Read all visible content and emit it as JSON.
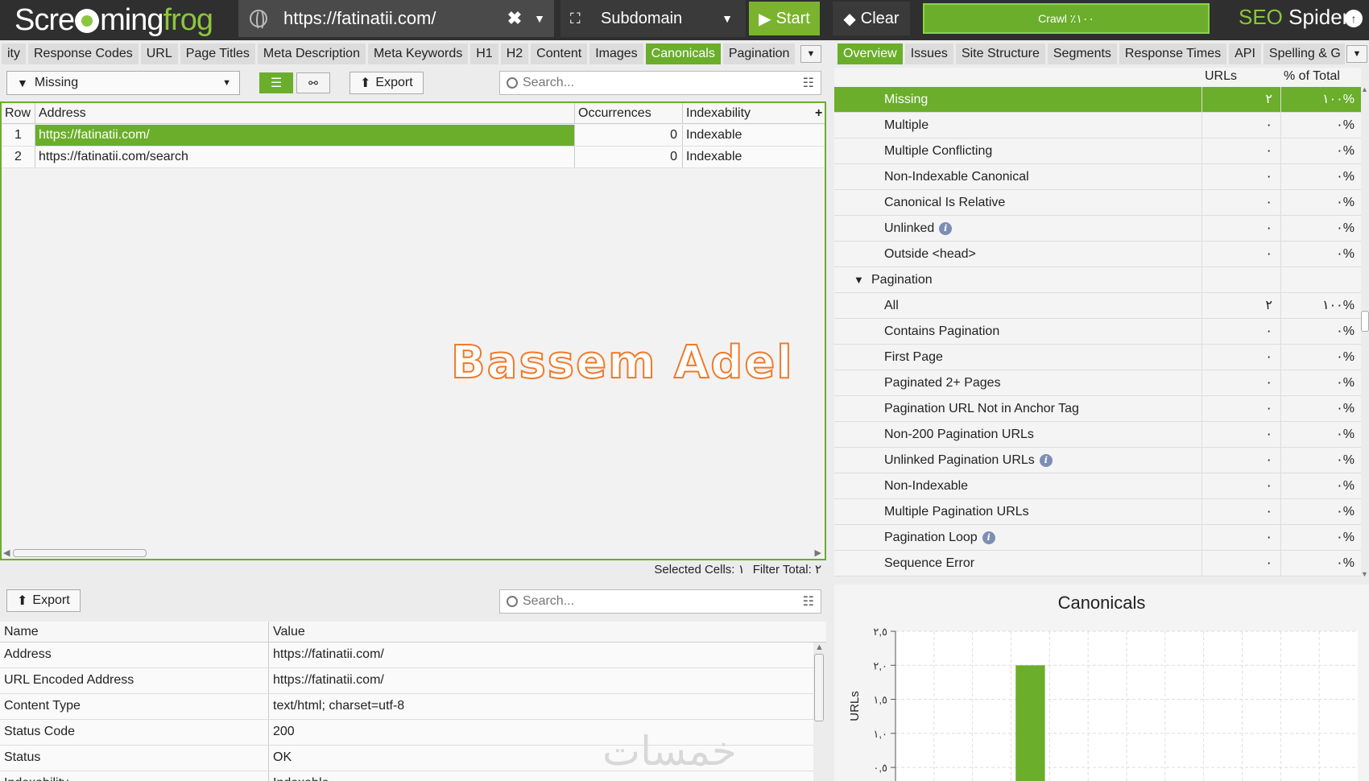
{
  "app": {
    "logo_scre": "Scre",
    "logo_ming": "ming",
    "logo_frog": "frog",
    "seo": "SEO",
    "spider": "Spider",
    "icons": {
      "globe": "globe-icon",
      "subdomain": "sitemap-icon",
      "start": "play-icon",
      "clear": "eraser-icon",
      "upload": "upload-icon"
    }
  },
  "topbar": {
    "url": "https://fatinatii.com/",
    "clear_x": "✖",
    "mode": "Subdomain",
    "start": "Start",
    "clear": "Clear",
    "crawl_status": "Crawl ٪١٠٠"
  },
  "left_tabs": [
    "ity",
    "Response Codes",
    "URL",
    "Page Titles",
    "Meta Description",
    "Meta Keywords",
    "H1",
    "H2",
    "Content",
    "Images",
    "Canonicals",
    "Pagination"
  ],
  "left_active_tab": "Canonicals",
  "right_tabs": [
    "Overview",
    "Issues",
    "Site Structure",
    "Segments",
    "Response Times",
    "API",
    "Spelling & G"
  ],
  "right_active_tab": "Overview",
  "filter": {
    "selected": "Missing"
  },
  "toolbar": {
    "export": "Export",
    "search_placeholder": "Search..."
  },
  "grid": {
    "columns": [
      "Row",
      "Address",
      "Occurrences",
      "Indexability",
      "+"
    ],
    "rows": [
      {
        "row": "1",
        "address": "https://fatinatii.com/",
        "occurrences": "0",
        "indexability": "Indexable",
        "selected": true
      },
      {
        "row": "2",
        "address": "https://fatinatii.com/search",
        "occurrences": "0",
        "indexability": "Indexable",
        "selected": false
      }
    ]
  },
  "overlay": {
    "name": "Bassem Adel",
    "site": "خمسات"
  },
  "status": {
    "selected_cells": "Selected Cells: ١",
    "filter_total": "Filter Total: ٢"
  },
  "details": {
    "export": "Export",
    "search_placeholder": "Search...",
    "columns": [
      "Name",
      "Value"
    ],
    "rows": [
      {
        "name": "Address",
        "value": "https://fatinatii.com/"
      },
      {
        "name": "URL Encoded Address",
        "value": "https://fatinatii.com/"
      },
      {
        "name": "Content Type",
        "value": "text/html; charset=utf-8"
      },
      {
        "name": "Status Code",
        "value": "200"
      },
      {
        "name": "Status",
        "value": "OK"
      },
      {
        "name": "Indexability",
        "value": "Indexable"
      }
    ]
  },
  "overview": {
    "columns": {
      "urls": "URLs",
      "pct": "% of Total"
    },
    "rows": [
      {
        "label": "Missing",
        "urls": "٢",
        "pct": "١٠٠%",
        "active": true,
        "info": false,
        "group": false
      },
      {
        "label": "Multiple",
        "urls": "٠",
        "pct": "٠%",
        "active": false,
        "info": false,
        "group": false
      },
      {
        "label": "Multiple Conflicting",
        "urls": "٠",
        "pct": "٠%",
        "active": false,
        "info": false,
        "group": false
      },
      {
        "label": "Non-Indexable Canonical",
        "urls": "٠",
        "pct": "٠%",
        "active": false,
        "info": false,
        "group": false
      },
      {
        "label": "Canonical Is Relative",
        "urls": "٠",
        "pct": "٠%",
        "active": false,
        "info": false,
        "group": false
      },
      {
        "label": "Unlinked",
        "urls": "٠",
        "pct": "٠%",
        "active": false,
        "info": true,
        "group": false
      },
      {
        "label": "Outside <head>",
        "urls": "٠",
        "pct": "٠%",
        "active": false,
        "info": false,
        "group": false
      },
      {
        "label": "Pagination",
        "urls": "",
        "pct": "",
        "active": false,
        "info": false,
        "group": true
      },
      {
        "label": "All",
        "urls": "٢",
        "pct": "١٠٠%",
        "active": false,
        "info": false,
        "group": false
      },
      {
        "label": "Contains Pagination",
        "urls": "٠",
        "pct": "٠%",
        "active": false,
        "info": false,
        "group": false
      },
      {
        "label": "First Page",
        "urls": "٠",
        "pct": "٠%",
        "active": false,
        "info": false,
        "group": false
      },
      {
        "label": "Paginated 2+ Pages",
        "urls": "٠",
        "pct": "٠%",
        "active": false,
        "info": false,
        "group": false
      },
      {
        "label": "Pagination URL Not in Anchor Tag",
        "urls": "٠",
        "pct": "٠%",
        "active": false,
        "info": false,
        "group": false
      },
      {
        "label": "Non-200 Pagination URLs",
        "urls": "٠",
        "pct": "٠%",
        "active": false,
        "info": false,
        "group": false
      },
      {
        "label": "Unlinked Pagination URLs",
        "urls": "٠",
        "pct": "٠%",
        "active": false,
        "info": true,
        "group": false
      },
      {
        "label": "Non-Indexable",
        "urls": "٠",
        "pct": "٠%",
        "active": false,
        "info": false,
        "group": false
      },
      {
        "label": "Multiple Pagination URLs",
        "urls": "٠",
        "pct": "٠%",
        "active": false,
        "info": false,
        "group": false
      },
      {
        "label": "Pagination Loop",
        "urls": "٠",
        "pct": "٠%",
        "active": false,
        "info": true,
        "group": false
      },
      {
        "label": "Sequence Error",
        "urls": "٠",
        "pct": "٠%",
        "active": false,
        "info": false,
        "group": false
      }
    ]
  },
  "colors": {
    "accent": "#6aae2b",
    "topbar": "#2f2f2f"
  },
  "chart_data": {
    "type": "bar",
    "title": "Canonicals",
    "ylabel": "URLs",
    "y_ticks": [
      "٠,٥",
      "١,٠",
      "١,٥",
      "٢,٠",
      "٢,٥"
    ],
    "y_tick_values": [
      0.5,
      1.0,
      1.5,
      2.0,
      2.5
    ],
    "ylim": [
      0.3,
      2.5
    ],
    "values": [
      2
    ],
    "bar_index": 3,
    "category_count": 12,
    "bar_color": "#6aae2b"
  }
}
